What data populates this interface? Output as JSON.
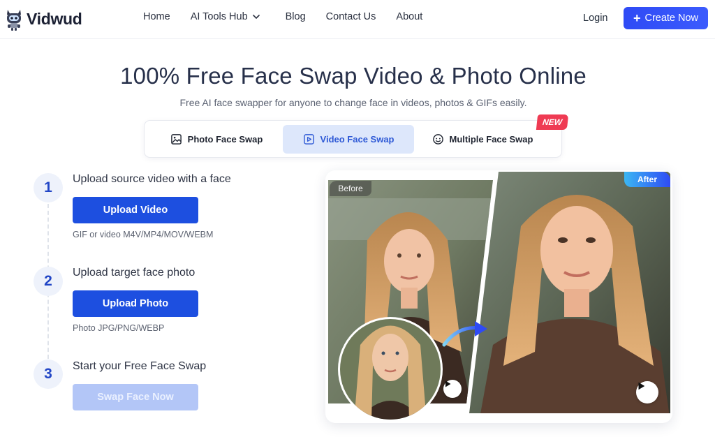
{
  "header": {
    "logo_text": "Vidwud",
    "nav": [
      {
        "label": "Home"
      },
      {
        "label": "AI Tools Hub"
      },
      {
        "label": "Blog"
      },
      {
        "label": "Contact Us"
      },
      {
        "label": "About"
      }
    ],
    "login_label": "Login",
    "create_label": "Create Now"
  },
  "hero": {
    "title": "100% Free Face Swap Video & Photo Online",
    "subtitle": "Free AI face swapper for anyone to change face in videos, photos & GIFs easily."
  },
  "tabs": {
    "items": [
      {
        "label": "Photo Face Swap",
        "icon": "image-icon"
      },
      {
        "label": "Video Face Swap",
        "icon": "video-icon",
        "active": true
      },
      {
        "label": "Multiple Face Swap",
        "icon": "multi-face-icon"
      }
    ],
    "new_badge": "NEW"
  },
  "steps": [
    {
      "number": "1",
      "title": "Upload source video with a face",
      "button": "Upload Video",
      "hint": "GIF or video M4V/MP4/MOV/WEBM"
    },
    {
      "number": "2",
      "title": "Upload target face photo",
      "button": "Upload Photo",
      "hint": "Photo JPG/PNG/WEBP"
    },
    {
      "number": "3",
      "title": "Start your Free Face Swap",
      "button": "Swap Face Now"
    }
  ],
  "preview": {
    "before_label": "Before",
    "after_label": "After"
  },
  "colors": {
    "accent": "#1d4fe0",
    "active_tab_bg": "#dde7fb",
    "badge": "#ef3b53"
  }
}
